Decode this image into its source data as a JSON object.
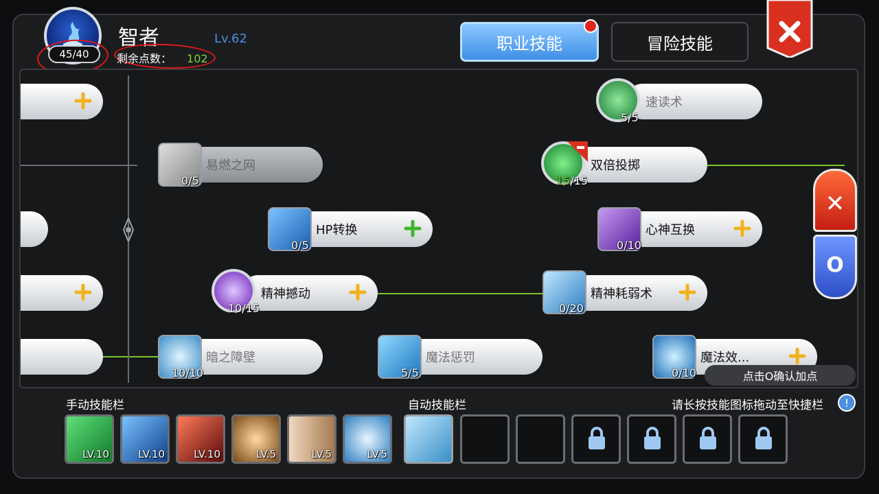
{
  "header": {
    "char_name": "智者",
    "char_level": "Lv.62",
    "skill_points_badge": "45/40",
    "remaining_label": "剩余点数：",
    "remaining_value": "102",
    "tab_job": "职业技能",
    "tab_adventure": "冒险技能"
  },
  "skills": [
    {
      "name": "速读术",
      "level": "5/5"
    },
    {
      "name": "易燃之网",
      "level": "0/5"
    },
    {
      "name": "双倍投掷",
      "level_cur": "15",
      "level_max": "/15"
    },
    {
      "name": "HP转换",
      "level": "0/5"
    },
    {
      "name": "心神互换",
      "level": "0/10"
    },
    {
      "name": "精神撼动",
      "level": "10/15"
    },
    {
      "name": "精神耗弱术",
      "level": "0/20"
    },
    {
      "name": "暗之障壁",
      "level": "10/10"
    },
    {
      "name": "魔法惩罚",
      "level": "5/5"
    },
    {
      "name": "魔法效...",
      "level": "0/10"
    }
  ],
  "confirm_tip": "点击O确认加点",
  "bottom": {
    "manual_label": "手动技能栏",
    "auto_label": "自动技能栏",
    "hint": "请长按技能图标拖动至快捷栏",
    "manual_slots": [
      {
        "level": "LV.10",
        "color": "#1f8f3a"
      },
      {
        "level": "LV.10",
        "color": "#1a5fb0"
      },
      {
        "level": "LV.10",
        "color": "#8a1414"
      },
      {
        "level": "LV.5",
        "color": "#a86a2a"
      },
      {
        "level": "LV.5",
        "color": "#b8906a"
      },
      {
        "level": "LV.5",
        "color": "#3f8fc8"
      }
    ]
  },
  "icons": {
    "close": "close-x-icon",
    "confirm": "circle-o-icon",
    "plus": "plus-icon",
    "lock": "lock-icon",
    "info": "info-icon"
  },
  "info_glyph": "!",
  "side_buttons": {
    "x_glyph": "✕",
    "o_glyph": "O"
  }
}
